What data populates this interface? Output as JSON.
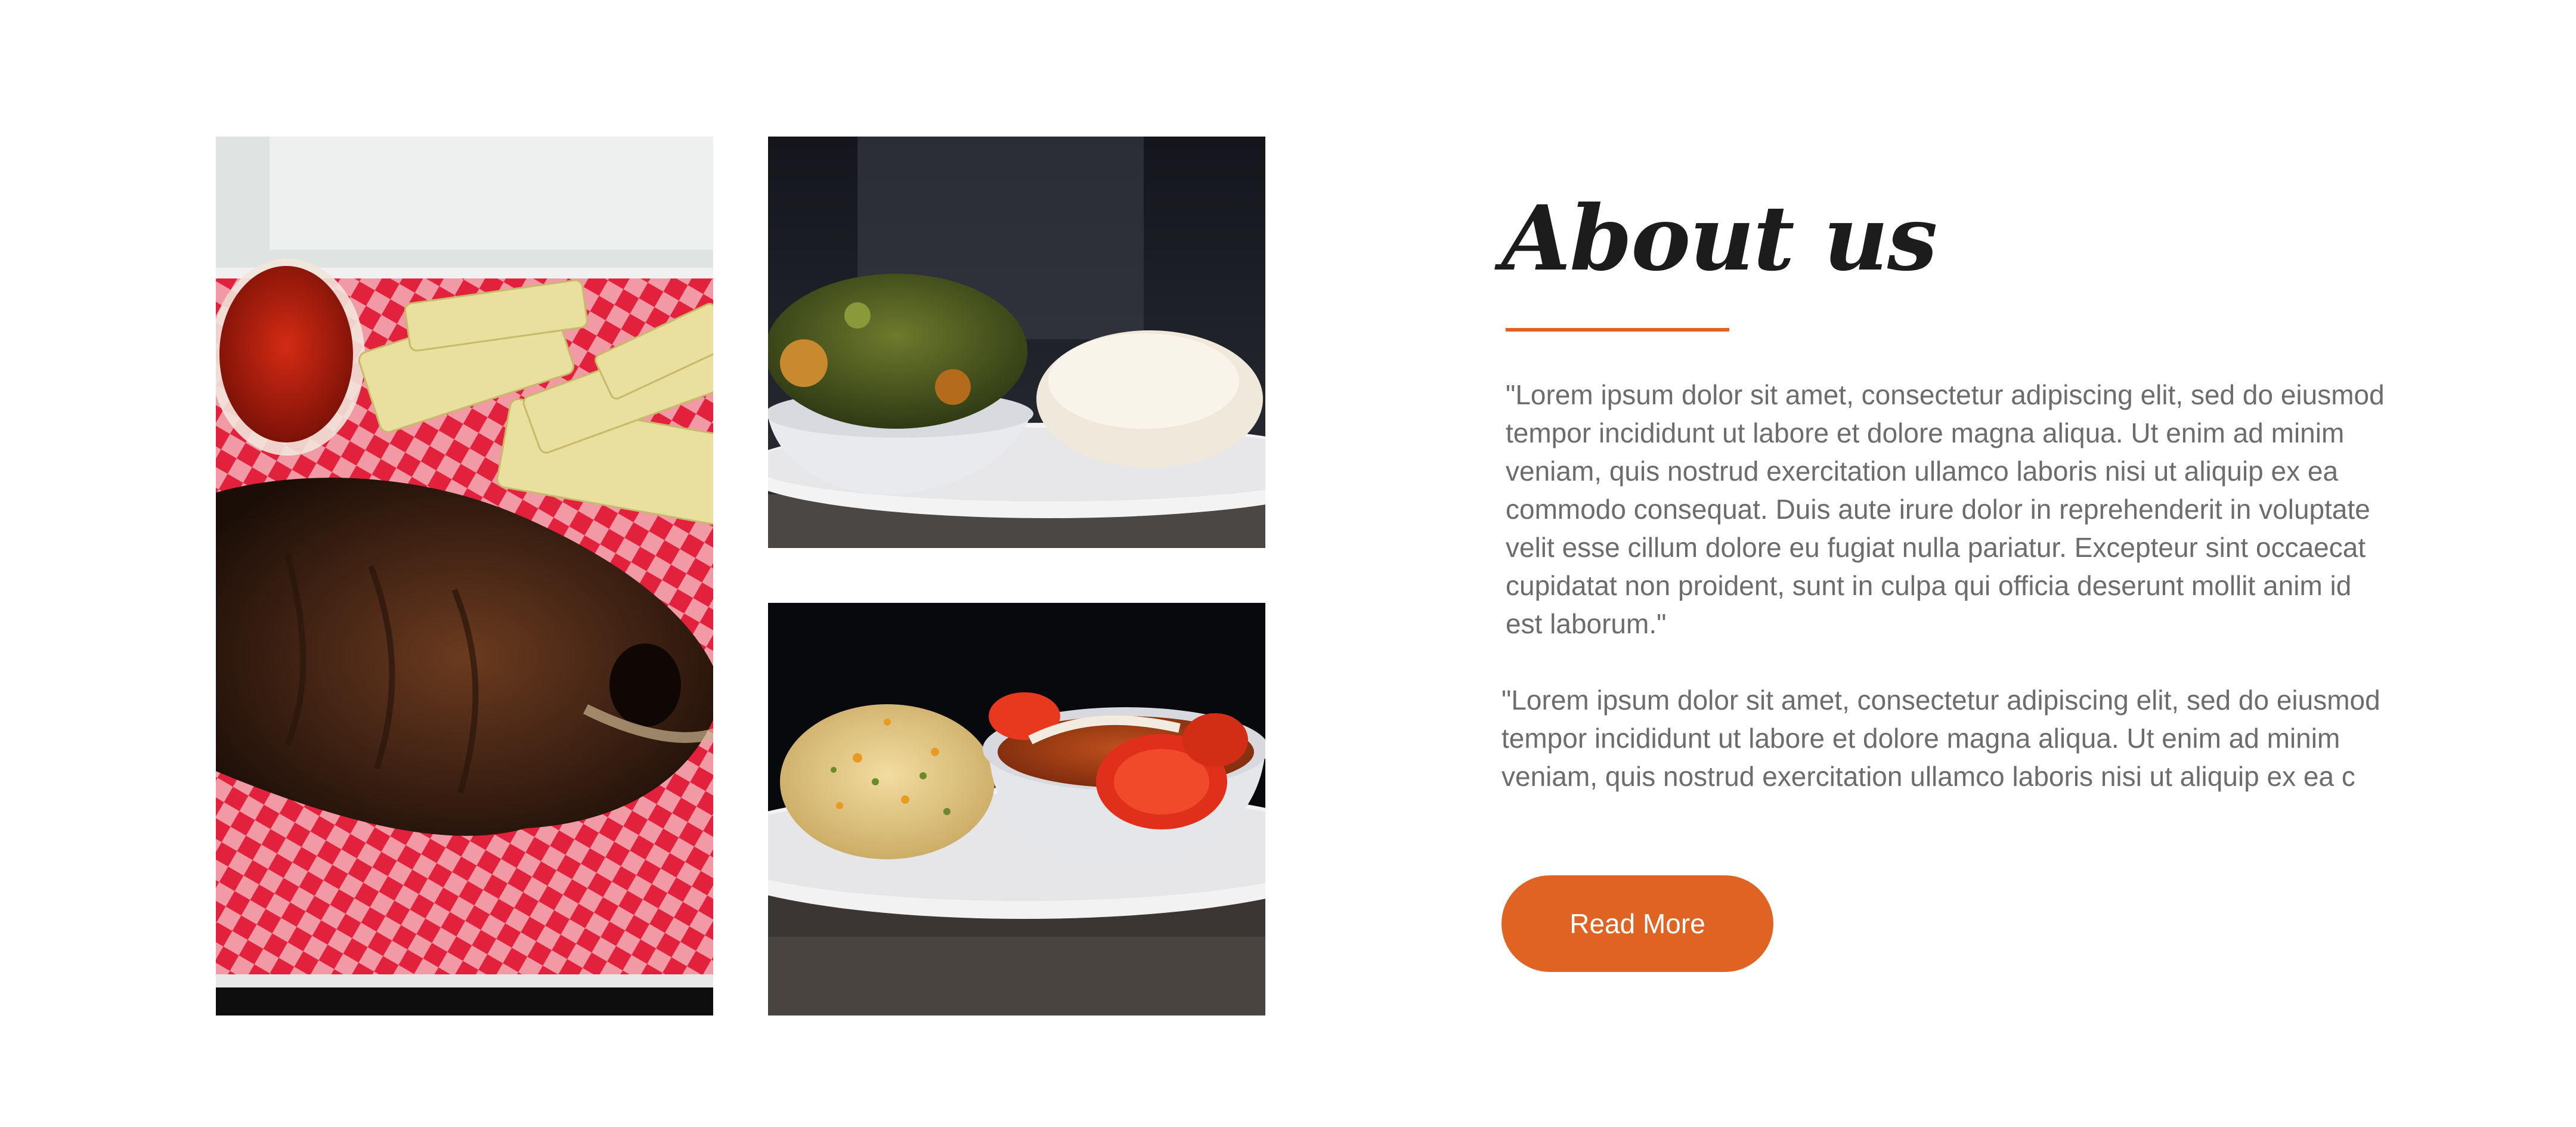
{
  "about": {
    "title": "About us",
    "paragraph_1": "\"Lorem ipsum dolor sit amet, consectetur adipiscing elit, sed do eiusmod tempor incididunt ut labore et dolore magna aliqua. Ut enim ad minim veniam, quis nostrud exercitation ullamco laboris nisi ut aliquip ex ea commodo consequat. Duis aute irure dolor in reprehenderit in voluptate velit esse cillum dolore eu fugiat nulla pariatur. Excepteur sint occaecat cupidatat non proident, sunt in culpa qui officia deserunt mollit anim id est laborum.\"",
    "paragraph_2": "\"Lorem ipsum dolor sit amet, consectetur adipiscing elit, sed do eiusmod tempor incididunt ut labore et dolore magna aliqua. Ut enim ad minim veniam, quis nostrud exercitation ullamco laboris nisi ut aliquip ex ea c",
    "read_more_label": "Read More"
  },
  "colors": {
    "accent": "#df6423",
    "heading": "#1c1c1c",
    "body_text": "#6c6c6c"
  }
}
